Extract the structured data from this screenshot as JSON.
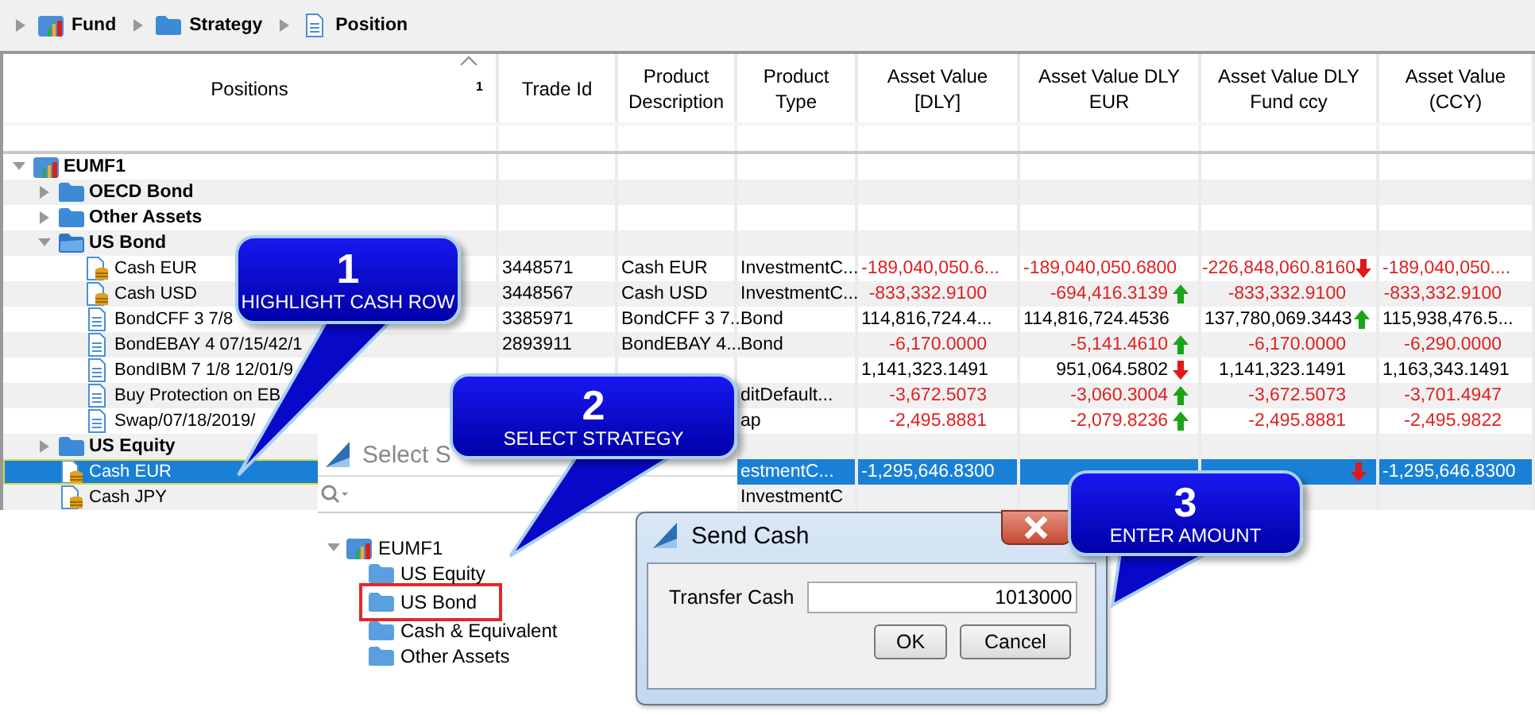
{
  "breadcrumb": [
    {
      "label": "Fund",
      "kind": "fund"
    },
    {
      "label": "Strategy",
      "kind": "strategy"
    },
    {
      "label": "Position",
      "kind": "security"
    }
  ],
  "table": {
    "columns": [
      {
        "label": "Positions",
        "sort_rank": "1"
      },
      {
        "label": "Trade Id"
      },
      {
        "label": "Product Description"
      },
      {
        "label": "Product Type"
      },
      {
        "label": "Asset Value [DLY]"
      },
      {
        "label": "Asset Value DLY EUR"
      },
      {
        "label": "Asset Value DLY Fund ccy"
      },
      {
        "label": "Asset Value (CCY)"
      }
    ],
    "rows": [
      {
        "label": "EUMF1",
        "kind": "fund",
        "expanded": true,
        "selected": false,
        "children": [
          {
            "label": "OECD Bond",
            "kind": "strategy",
            "expanded": false,
            "selected": false
          },
          {
            "label": "Other Assets",
            "kind": "strategy",
            "expanded": false,
            "selected": false
          },
          {
            "label": "US Bond",
            "kind": "strategy",
            "expanded": true,
            "selected": false,
            "children": [
              {
                "label": "Cash EUR",
                "kind": "cash",
                "selected": false,
                "cells": {
                  "trade_id": "3448571",
                  "description": "Cash EUR",
                  "product_type": "InvestmentC...",
                  "av_dly": {
                    "text": "-189,040,050.6...",
                    "negative": true
                  },
                  "av_eur": {
                    "text": "-189,040,050.6800",
                    "negative": true
                  },
                  "av_fund": {
                    "text": "-226,848,060.8160",
                    "negative": true,
                    "rising": false
                  },
                  "av_ccy": {
                    "text": "-189,040,050....",
                    "negative": true
                  }
                }
              },
              {
                "label": "Cash USD",
                "kind": "cash",
                "selected": false,
                "cells": {
                  "trade_id": "3448567",
                  "description": "Cash USD",
                  "product_type": "InvestmentC...",
                  "av_dly": {
                    "text": "-833,332.9100",
                    "negative": true
                  },
                  "av_eur": {
                    "text": "-694,416.3139",
                    "negative": true,
                    "rising": true
                  },
                  "av_fund": {
                    "text": "-833,332.9100",
                    "negative": true
                  },
                  "av_ccy": {
                    "text": "-833,332.9100",
                    "negative": true
                  }
                }
              },
              {
                "label": "BondCFF 3 7/8",
                "kind": "security",
                "selected": false,
                "cells": {
                  "trade_id": "3385971",
                  "description": "BondCFF 3 7...",
                  "product_type": "Bond",
                  "av_dly": {
                    "text": "114,816,724.4...",
                    "negative": false
                  },
                  "av_eur": {
                    "text": "114,816,724.4536",
                    "negative": false
                  },
                  "av_fund": {
                    "text": "137,780,069.3443",
                    "negative": false,
                    "rising": true
                  },
                  "av_ccy": {
                    "text": "115,938,476.5...",
                    "negative": false
                  }
                }
              },
              {
                "label": "BondEBAY 4 07/15/42/1",
                "kind": "security",
                "selected": false,
                "cells": {
                  "trade_id": "2893911",
                  "description": "BondEBAY 4...",
                  "product_type": "Bond",
                  "av_dly": {
                    "text": "-6,170.0000",
                    "negative": true
                  },
                  "av_eur": {
                    "text": "-5,141.4610",
                    "negative": true,
                    "rising": true
                  },
                  "av_fund": {
                    "text": "-6,170.0000",
                    "negative": true
                  },
                  "av_ccy": {
                    "text": "-6,290.0000",
                    "negative": true
                  }
                }
              },
              {
                "label": "BondIBM 7 1/8 12/01/9",
                "kind": "security",
                "selected": false,
                "cells": {
                  "av_dly": {
                    "text": "1,141,323.1491",
                    "negative": false
                  },
                  "av_eur": {
                    "text": "951,064.5802",
                    "negative": false,
                    "rising": false
                  },
                  "av_fund": {
                    "text": "1,141,323.1491",
                    "negative": false
                  },
                  "av_ccy": {
                    "text": "1,163,343.1491",
                    "negative": false
                  }
                }
              },
              {
                "label": "Buy Protection on EB",
                "kind": "security",
                "selected": false,
                "cells": {
                  "product_type": "ditDefault...",
                  "av_dly": {
                    "text": "-3,672.5073",
                    "negative": true
                  },
                  "av_eur": {
                    "text": "-3,060.3004",
                    "negative": true,
                    "rising": true
                  },
                  "av_fund": {
                    "text": "-3,672.5073",
                    "negative": true
                  },
                  "av_ccy": {
                    "text": "-3,701.4947",
                    "negative": true
                  }
                }
              },
              {
                "label": "Swap/07/18/2019/",
                "kind": "security",
                "selected": false,
                "cells": {
                  "product_type": "ap",
                  "av_dly": {
                    "text": "-2,495.8881",
                    "negative": true
                  },
                  "av_eur": {
                    "text": "-2,079.8236",
                    "negative": true,
                    "rising": true
                  },
                  "av_fund": {
                    "text": "-2,495.8881",
                    "negative": true
                  },
                  "av_ccy": {
                    "text": "-2,495.9822",
                    "negative": true
                  }
                }
              }
            ]
          },
          {
            "label": "US Equity",
            "kind": "strategy",
            "expanded": false,
            "selected": false
          },
          {
            "label": "Cash EUR",
            "kind": "cash",
            "selected": true,
            "cells": {
              "product_type": "estmentC...",
              "av_dly": {
                "text": "-1,295,646.8300"
              },
              "av_fund": {
                "rising": false
              },
              "av_ccy": {
                "text": "-1,295,646.8300"
              }
            }
          },
          {
            "label": "Cash JPY",
            "kind": "cash",
            "selected": false,
            "cells": {
              "product_type": "InvestmentC"
            }
          }
        ]
      }
    ]
  },
  "strategy_dialog": {
    "title": "Select S",
    "tree": {
      "label": "EUMF1",
      "expanded": true,
      "children": [
        {
          "label": "US Equity",
          "selected": false
        },
        {
          "label": "US Bond",
          "selected": true
        },
        {
          "label": "Cash & Equivalent",
          "selected": false
        },
        {
          "label": "Other Assets",
          "selected": false
        }
      ]
    }
  },
  "send_cash_dialog": {
    "title": "Send Cash",
    "field_label": "Transfer Cash",
    "value": "1013000",
    "buttons": [
      "OK",
      "Cancel"
    ]
  },
  "callouts": [
    {
      "number": "1",
      "caption": "HIGHLIGHT CASH ROW"
    },
    {
      "number": "2",
      "caption": "SELECT STRATEGY"
    },
    {
      "number": "3",
      "caption": "ENTER AMOUNT"
    }
  ]
}
